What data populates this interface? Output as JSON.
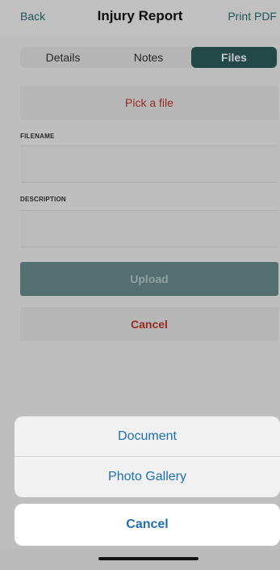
{
  "nav": {
    "back_label": "Back",
    "title": "Injury Report",
    "print_label": "Print PDF"
  },
  "tabs": [
    {
      "label": "Details",
      "selected": false
    },
    {
      "label": "Notes",
      "selected": false
    },
    {
      "label": "Files",
      "selected": true
    }
  ],
  "form": {
    "pick_file_label": "Pick a file",
    "filename_label": "FILENAME",
    "filename_value": "",
    "description_label": "DESCRIPTION",
    "description_value": "",
    "upload_label": "Upload",
    "cancel_label": "Cancel"
  },
  "action_sheet": {
    "options": [
      "Document",
      "Photo Gallery"
    ],
    "cancel_label": "Cancel"
  },
  "colors": {
    "accent": "#2d5d5d",
    "destructive": "#c0392b",
    "sheet_text": "#1f6fb3"
  }
}
